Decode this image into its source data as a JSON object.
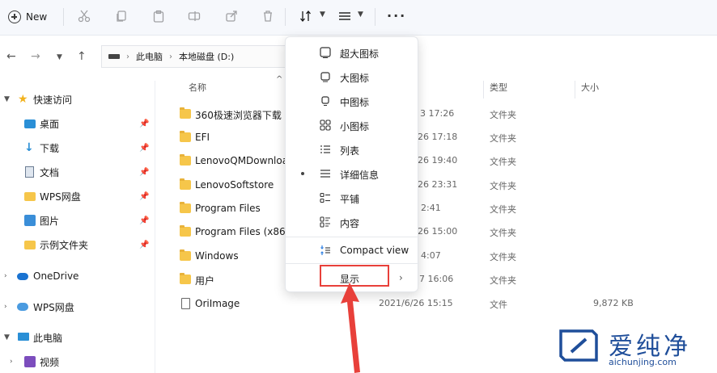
{
  "toolbar": {
    "new_label": "New",
    "more_label": "···"
  },
  "address": {
    "crumbs": [
      "此电脑",
      "本地磁盘 (D:)"
    ]
  },
  "sidebar": {
    "items": [
      {
        "label": "快速访问",
        "icon": "star-icon"
      },
      {
        "label": "桌面",
        "icon": "desktop-icon"
      },
      {
        "label": "下载",
        "icon": "download-icon"
      },
      {
        "label": "文档",
        "icon": "document-icon"
      },
      {
        "label": "WPS网盘",
        "icon": "folder-icon"
      },
      {
        "label": "图片",
        "icon": "picture-icon"
      },
      {
        "label": "示例文件夹",
        "icon": "folder-icon"
      },
      {
        "label": "OneDrive",
        "icon": "cloud-icon"
      },
      {
        "label": "WPS网盘",
        "icon": "wps-cloud-icon"
      },
      {
        "label": "此电脑",
        "icon": "computer-icon"
      },
      {
        "label": "视频",
        "icon": "video-icon"
      }
    ]
  },
  "columns": {
    "name": "名称",
    "type": "类型",
    "size": "大小"
  },
  "files": [
    {
      "name": "360极速浏览器下载",
      "date": "3 17:26",
      "type": "文件夹",
      "size": ""
    },
    {
      "name": "EFI",
      "date": "26 17:18",
      "type": "文件夹",
      "size": ""
    },
    {
      "name": "LenovoQMDownload",
      "date": "26 19:40",
      "type": "文件夹",
      "size": ""
    },
    {
      "name": "LenovoSoftstore",
      "date": "26 23:31",
      "type": "文件夹",
      "size": ""
    },
    {
      "name": "Program Files",
      "date": "2:41",
      "type": "文件夹",
      "size": ""
    },
    {
      "name": "Program Files (x86)",
      "date": "26 15:00",
      "type": "文件夹",
      "size": ""
    },
    {
      "name": "Windows",
      "date": "4:07",
      "type": "文件夹",
      "size": ""
    },
    {
      "name": "用户",
      "date": "7 16:06",
      "type": "文件夹",
      "size": ""
    },
    {
      "name": "OriImage",
      "date": "2021/6/26 15:15",
      "type": "文件",
      "size": "9,872 KB"
    }
  ],
  "menu": {
    "items": [
      {
        "label": "超大图标",
        "icon": "extra-large-icons-icon"
      },
      {
        "label": "大图标",
        "icon": "large-icons-icon"
      },
      {
        "label": "中图标",
        "icon": "medium-icons-icon"
      },
      {
        "label": "小图标",
        "icon": "small-icons-icon"
      },
      {
        "label": "列表",
        "icon": "list-icon"
      },
      {
        "label": "详细信息",
        "icon": "details-icon",
        "selected": true
      },
      {
        "label": "平铺",
        "icon": "tiles-icon"
      },
      {
        "label": "内容",
        "icon": "content-icon"
      }
    ],
    "compact_label": "Compact view",
    "show_label": "显示"
  },
  "watermark": {
    "title": "爱纯净",
    "url": "aichunjing.com"
  },
  "colors": {
    "accent_red": "#e8403a",
    "folder_yellow": "#f6c64a",
    "watermark_blue": "#1f4e9a"
  }
}
